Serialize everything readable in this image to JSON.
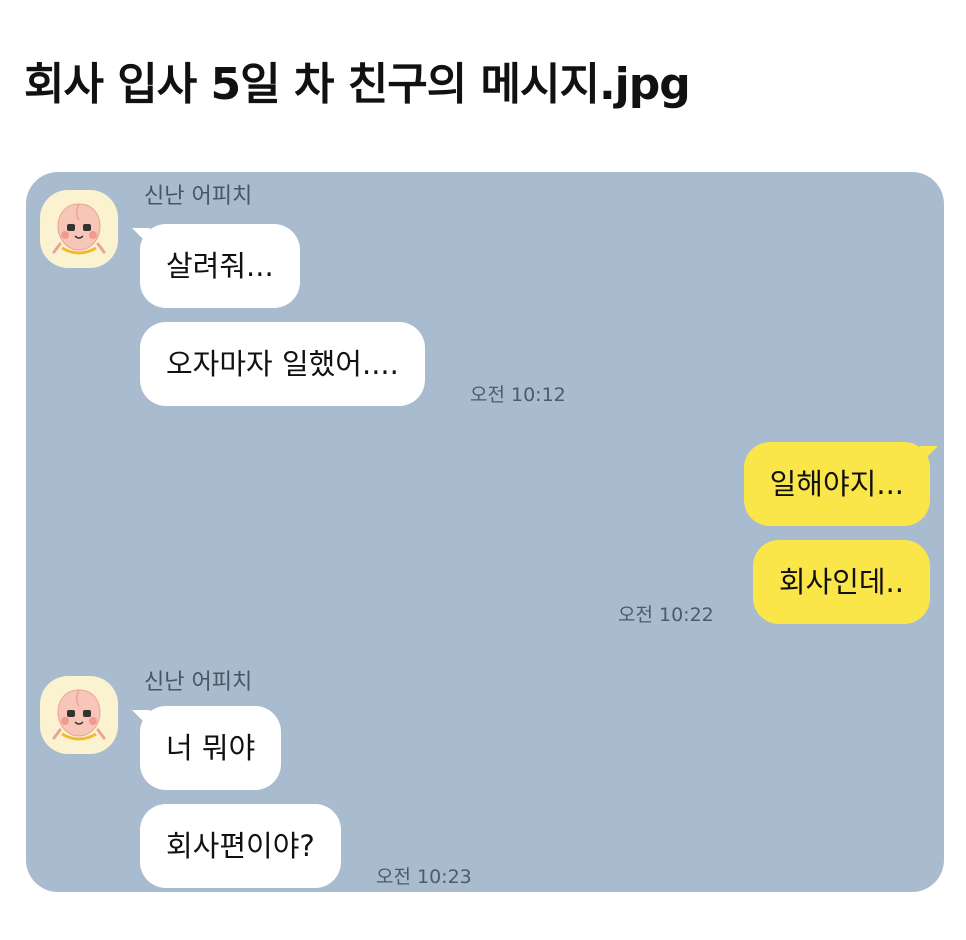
{
  "post": {
    "title": "회사 입사 5일 차 친구의 메시지.jpg"
  },
  "chat": {
    "background_color": "#a9bccf",
    "my_bubble_color": "#fbe64a",
    "their_bubble_color": "#ffffff",
    "groups": [
      {
        "sender": "신난 어피치",
        "avatar_icon": "apeach-avatar-icon",
        "messages": [
          "살려줘...",
          "오자마자 일했어...."
        ],
        "time": "오전 10:12"
      },
      {
        "sender": "me",
        "messages": [
          "일해야지...",
          "회사인데.."
        ],
        "time": "오전 10:22"
      },
      {
        "sender": "신난 어피치",
        "avatar_icon": "apeach-avatar-icon",
        "messages": [
          "너 뭐야",
          "회사편이야?"
        ],
        "time": "오전 10:23"
      }
    ]
  }
}
